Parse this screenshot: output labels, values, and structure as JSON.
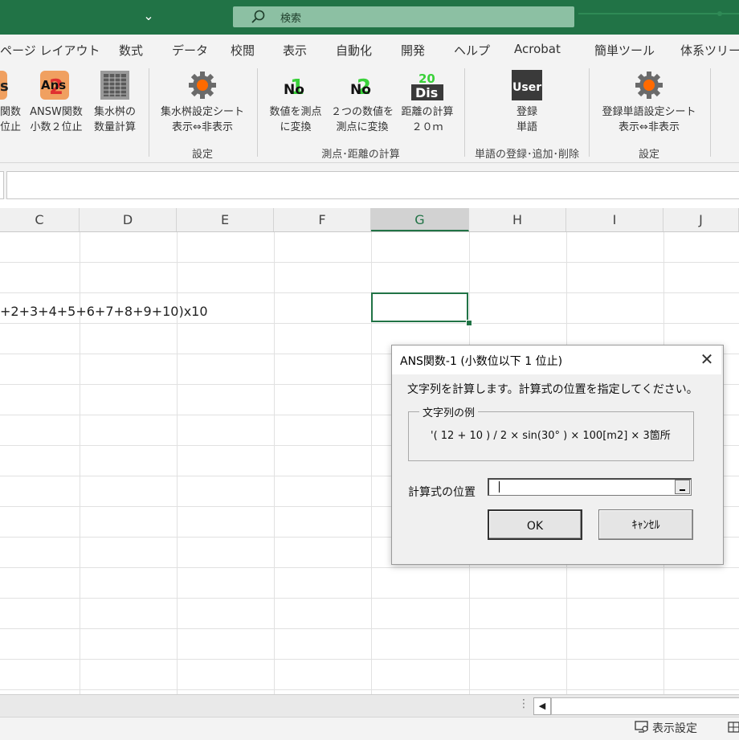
{
  "titlebar": {
    "search_placeholder": "検索",
    "accent": "#217346"
  },
  "menu": [
    "ページ レイアウト",
    "数式",
    "データ",
    "校閲",
    "表示",
    "自動化",
    "開発",
    "ヘルプ",
    "Acrobat",
    "簡単ツール",
    "体系ツリー"
  ],
  "ribbon": {
    "buttons": [
      {
        "icon": "ans-s-icon",
        "label1": "関数",
        "label2": "位止",
        "icon_text": "s"
      },
      {
        "icon": "answ-icon",
        "label1": "ANSW関数",
        "label2": "小数２位止",
        "icon_text": "Ans",
        "badge": "2"
      },
      {
        "icon": "catch-basin-icon",
        "label1": "集水桝の",
        "label2": "数量計算"
      },
      {
        "icon": "gear-icon",
        "label1": "集水桝設定シート",
        "label2": "表示⇔非表示"
      },
      {
        "icon": "no1-icon",
        "label1": "数値を測点",
        "label2": "に変換",
        "icon_text": "No",
        "badge": "1"
      },
      {
        "icon": "no2-icon",
        "label1": "２つの数値を",
        "label2": "測点に変換",
        "icon_text": "No",
        "badge": "2"
      },
      {
        "icon": "dis-icon",
        "label1": "距離の計算",
        "label2": "２０ｍ",
        "icon_text": "Dis",
        "badge": "20"
      },
      {
        "icon": "user-icon",
        "label1": "登録",
        "label2": "単語",
        "icon_text": "User"
      },
      {
        "icon": "gear-icon",
        "label1": "登録単語設定シート",
        "label2": "表示⇔非表示"
      }
    ],
    "groups": [
      "設定",
      "測点･距離の計算",
      "単語の登録･追加･削除",
      "設定"
    ]
  },
  "grid": {
    "columns": [
      "C",
      "D",
      "E",
      "F",
      "G",
      "H",
      "I",
      "J"
    ],
    "selected_column": "G",
    "cell_text": "+2+3+4+5+6+7+8+9+10)x10"
  },
  "status": {
    "display_settings": "表示設定"
  },
  "dialog": {
    "title": "ANS関数-1 (小数位以下 1 位止)",
    "message": "文字列を計算します。計算式の位置を指定してください。",
    "example_legend": "文字列の例",
    "example_text": "'( 12 + 10 ) / 2 × sin(30° ) × 100[m2] × 3箇所",
    "position_label": "計算式の位置",
    "position_value": "",
    "ok": "OK",
    "cancel": "ｷｬﾝｾﾙ"
  }
}
